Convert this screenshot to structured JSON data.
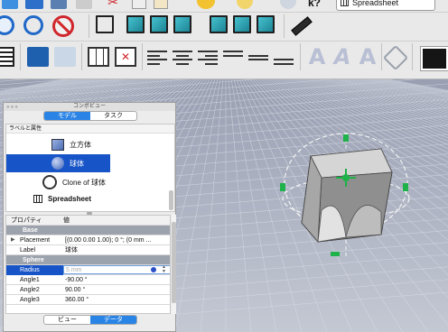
{
  "toolbar": {
    "spreadsheet_label": "Spreadsheet"
  },
  "combo_view": {
    "title": "コンボビュー",
    "tabs": [
      {
        "label": "モデル",
        "active": true
      },
      {
        "label": "タスク",
        "active": false
      }
    ],
    "tree_header": "ラベルと属性",
    "tree_items": [
      {
        "label": "立方体",
        "icon": "cube-icon",
        "selected": false
      },
      {
        "label": "球体",
        "icon": "sphere-icon",
        "selected": true
      },
      {
        "label": "Clone of 球体",
        "icon": "clone-icon",
        "selected": false
      },
      {
        "label": "Spreadsheet",
        "icon": "spreadsheet-icon",
        "selected": false
      }
    ],
    "properties_header": {
      "property": "プロパティ",
      "value": "値"
    },
    "properties": [
      {
        "group": "Base"
      },
      {
        "name": "Placement",
        "value": "[(0.00 0.00 1.00); 0 °; (0 mm ...",
        "expandable": true
      },
      {
        "name": "Label",
        "value": "球体"
      },
      {
        "group": "Sphere"
      },
      {
        "name": "Radius",
        "value": "5 mm",
        "selected": true
      },
      {
        "name": "Angle1",
        "value": "-90.00 °"
      },
      {
        "name": "Angle2",
        "value": "90.00 °"
      },
      {
        "name": "Angle3",
        "value": "360.00 °"
      }
    ],
    "bottom_tabs": [
      {
        "label": "ビュー",
        "active": false
      },
      {
        "label": "データ",
        "active": true
      }
    ]
  },
  "colors": {
    "accent": "#2a84e6",
    "selection": "#1754c7",
    "group_header": "#9da3ad",
    "teal_icon": "#2aa6b8"
  }
}
